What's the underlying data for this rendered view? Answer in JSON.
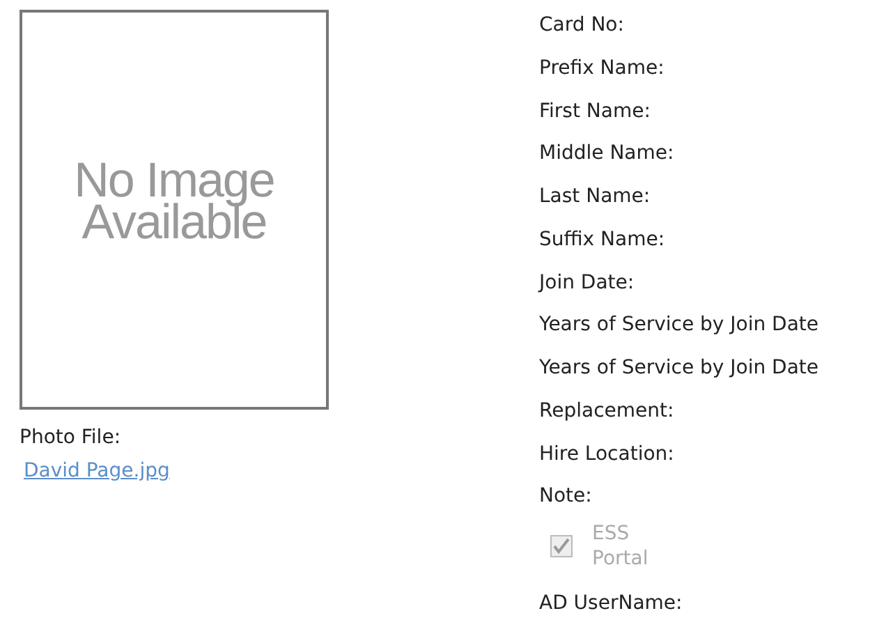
{
  "photo": {
    "placeholder_text": [
      "No Image",
      "Available"
    ],
    "file_label": "Photo File:",
    "file_link": "David Page.jpg"
  },
  "fields": [
    {
      "kind": "label",
      "label": "Card No:"
    },
    {
      "kind": "label",
      "label": "Prefix Name:"
    },
    {
      "kind": "label",
      "label": "First Name:"
    },
    {
      "kind": "label",
      "label": "Middle Name:"
    },
    {
      "kind": "label",
      "label": "Last Name:"
    },
    {
      "kind": "label",
      "label": "Suffix Name:"
    },
    {
      "kind": "label",
      "label": "Join Date:"
    },
    {
      "kind": "label",
      "label": "Years of Service by Join Date"
    },
    {
      "kind": "label",
      "label": "Years of Service by Join Date"
    },
    {
      "kind": "label",
      "label": "Replacement:"
    },
    {
      "kind": "label",
      "label": "Hire Location:"
    },
    {
      "kind": "label",
      "label": "Note:"
    },
    {
      "kind": "checkbox",
      "label": [
        "ESS",
        "Portal"
      ],
      "checked": true,
      "disabled": true
    },
    {
      "kind": "label",
      "label": "AD UserName:"
    }
  ]
}
